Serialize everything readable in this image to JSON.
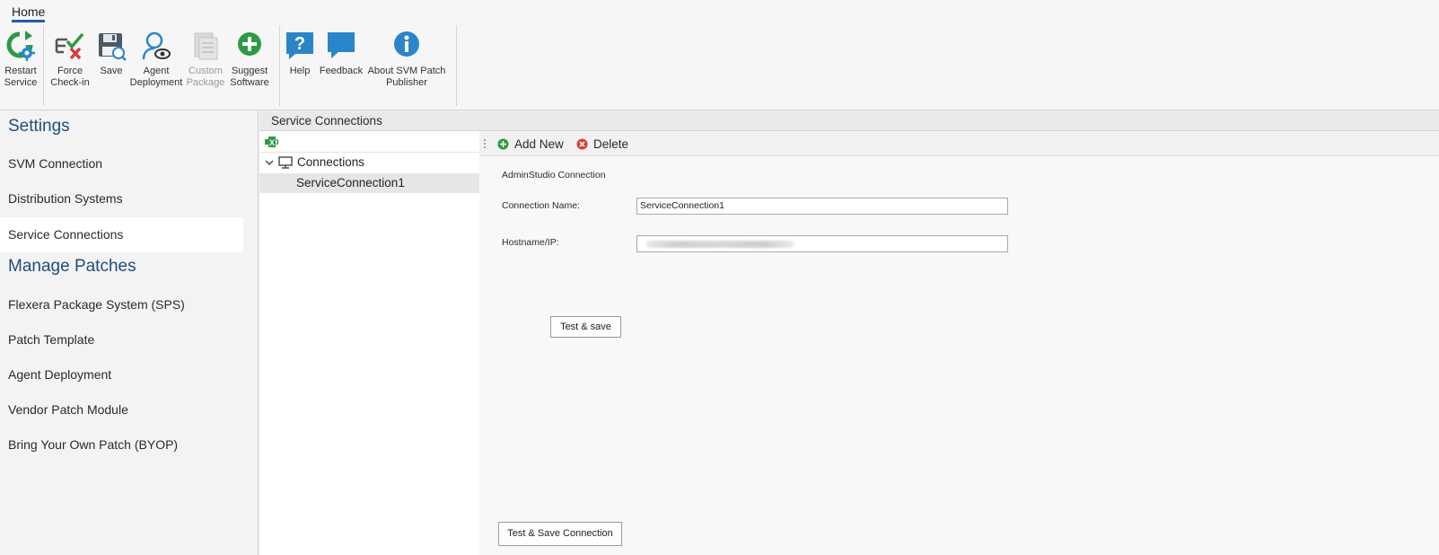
{
  "ribbon": {
    "tab": "Home",
    "group1": [
      {
        "name": "restart-service",
        "label1": "Restart",
        "label2": "Service",
        "icon": "restart-gear-icon",
        "disabled": false
      },
      {
        "name": "force-check-in",
        "label1": "Force",
        "label2": "Check-in",
        "icon": "force-checkin-icon",
        "disabled": false
      },
      {
        "name": "save",
        "label1": "Save",
        "label2": "",
        "icon": "floppy-disk-icon",
        "disabled": false
      },
      {
        "name": "agent-deployment",
        "label1": "Agent",
        "label2": "Deployment",
        "icon": "agent-search-icon",
        "disabled": false
      },
      {
        "name": "custom-package",
        "label1": "Custom",
        "label2": "Package",
        "icon": "custom-package-icon",
        "disabled": true
      },
      {
        "name": "suggest-software",
        "label1": "Suggest",
        "label2": "Software",
        "icon": "plus-circle-icon",
        "disabled": false
      }
    ],
    "group2": [
      {
        "name": "help",
        "label1": "Help",
        "label2": "",
        "icon": "help-bubble-icon"
      },
      {
        "name": "feedback",
        "label1": "Feedback",
        "label2": "",
        "icon": "feedback-bubble-icon"
      },
      {
        "name": "about",
        "label1": "About SVM Patch",
        "label2": "Publisher",
        "icon": "info-icon"
      }
    ]
  },
  "nav": {
    "settings_heading": "Settings",
    "settings_items": [
      "SVM Connection",
      "Distribution Systems",
      "Service Connections"
    ],
    "active_item": "Service Connections",
    "patches_heading": "Manage Patches",
    "patches_items": [
      "Flexera Package System (SPS)",
      "Patch Template",
      "Agent Deployment",
      "Vendor Patch Module",
      "Bring Your Own Patch (BYOP)"
    ]
  },
  "panel": {
    "title": "Service Connections"
  },
  "tree": {
    "root_label": "Connections",
    "child_label": "ServiceConnection1"
  },
  "detail": {
    "add_new": "Add New",
    "delete": "Delete",
    "section_title": "AdminStudio Connection",
    "connection_name_label": "Connection Name:",
    "connection_name_value": "ServiceConnection1",
    "hostname_label": "Hostname/IP:",
    "test_save": "Test & save",
    "test_save_connection": "Test & Save Connection"
  },
  "colors": {
    "accent_blue": "#1f5fa6",
    "heading_blue": "#1f4e7a",
    "green": "#2e9a44",
    "red": "#d93b3b",
    "icon_blue": "#2a86c9"
  }
}
